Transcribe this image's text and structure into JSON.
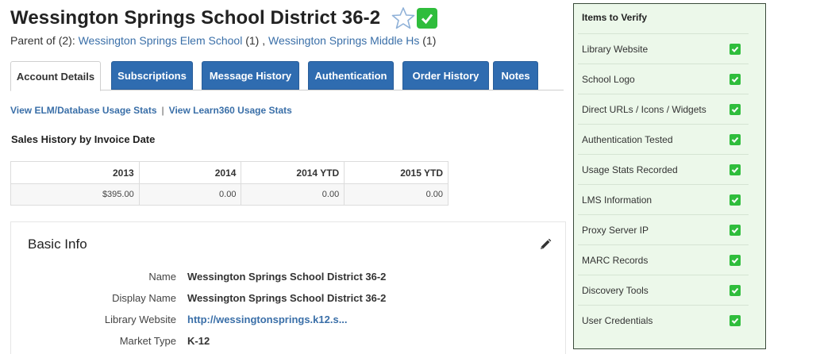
{
  "header": {
    "title": "Wessington Springs School District 36-2",
    "parent_prefix": "Parent of (2):",
    "parents": [
      {
        "name": "Wessington Springs Elem School",
        "count": "(1)"
      },
      {
        "name": "Wessington Springs Middle Hs",
        "count": "(1)"
      }
    ],
    "parent_separator": ","
  },
  "tabs": [
    {
      "label": "Account Details",
      "active": true
    },
    {
      "label": "Subscriptions",
      "active": false
    },
    {
      "label": "Message History",
      "active": false
    },
    {
      "label": "Authentication",
      "active": false
    },
    {
      "label": "Order History",
      "active": false
    },
    {
      "label": "Notes",
      "active": false
    }
  ],
  "stats_links": {
    "elm": "View ELM/Database Usage Stats",
    "separator": "|",
    "learn360": "View Learn360 Usage Stats"
  },
  "sales": {
    "title": "Sales History by Invoice Date",
    "columns": [
      "2013",
      "2014",
      "2014 YTD",
      "2015 YTD"
    ],
    "values": [
      "$395.00",
      "0.00",
      "0.00",
      "0.00"
    ]
  },
  "basic_info": {
    "title": "Basic Info",
    "rows": [
      {
        "label": "Name",
        "value": "Wessington Springs School District 36-2"
      },
      {
        "label": "Display Name",
        "value": "Wessington Springs School District 36-2"
      },
      {
        "label": "Library Website",
        "value": "http://wessingtonsprings.k12.s..."
      },
      {
        "label": "Market Type",
        "value": "K-12"
      }
    ]
  },
  "verify": {
    "title": "Items to Verify",
    "items": [
      "Library Website",
      "School Logo",
      "Direct URLs / Icons / Widgets",
      "Authentication Tested",
      "Usage Stats Recorded",
      "LMS Information",
      "Proxy Server IP",
      "MARC Records",
      "Discovery Tools",
      "User Credentials"
    ]
  },
  "colors": {
    "tab_blue": "#2f6cb0",
    "link_blue": "#3a6fa8",
    "check_green": "#2fbd3c",
    "verify_bg": "#ecf8ea"
  }
}
